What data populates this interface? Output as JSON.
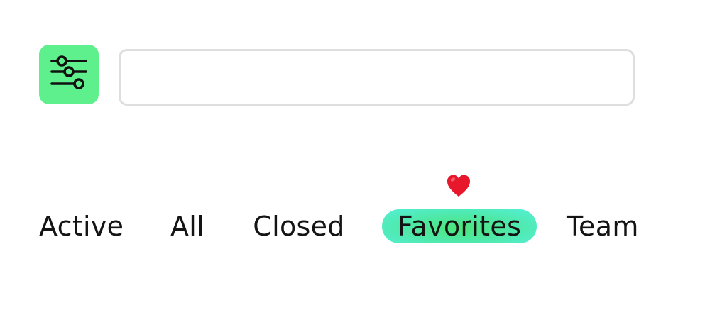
{
  "filter_button": {
    "icon": "sliders-icon",
    "color": "#5ef08c"
  },
  "search": {
    "value": "",
    "placeholder": ""
  },
  "tabs": [
    {
      "label": "Active"
    },
    {
      "label": "All"
    },
    {
      "label": "Closed"
    },
    {
      "label": "Favorites",
      "selected": true,
      "badge_icon": "heart-icon"
    },
    {
      "label": "Team"
    }
  ],
  "colors": {
    "accent_green": "#5ef08c",
    "selected_tab_gradient_start": "#4ce67a",
    "selected_tab_gradient_end": "#55f0d8",
    "heart": "#e8182c",
    "input_border": "#dedede"
  }
}
